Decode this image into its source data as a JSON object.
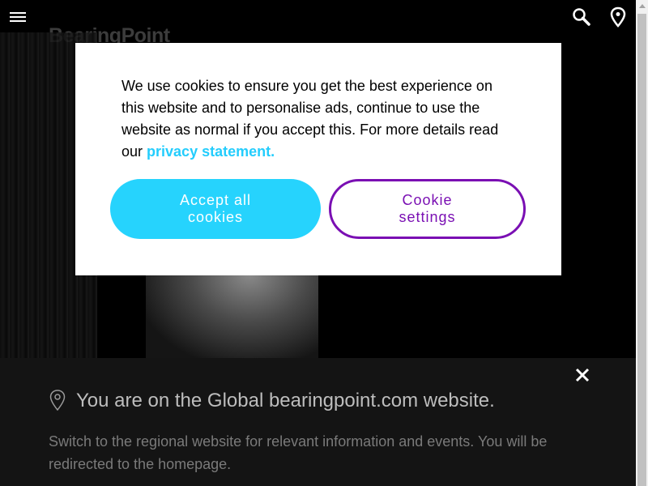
{
  "header": {
    "logo_text": "BearingPoint",
    "menu_icon": "hamburger-menu-icon",
    "search_icon": "search-icon",
    "location_icon": "location-pin-icon"
  },
  "cookie_banner": {
    "text": "We use cookies to ensure you get the best experience on this website and to personalise ads, continue to use the website as normal if you accept this. For more details read our",
    "link_text": "privacy statement.",
    "accept_label": "Accept all cookies",
    "settings_label": "Cookie settings"
  },
  "region_banner": {
    "title": "You are on the Global bearingpoint.com website.",
    "description": "Switch to the regional website for relevant information and events. You will be redirected to the homepage.",
    "close_icon": "close-icon"
  },
  "colors": {
    "accent_cyan": "#26d3fd",
    "accent_purple": "#7a0fb3",
    "banner_bg": "#141414"
  }
}
